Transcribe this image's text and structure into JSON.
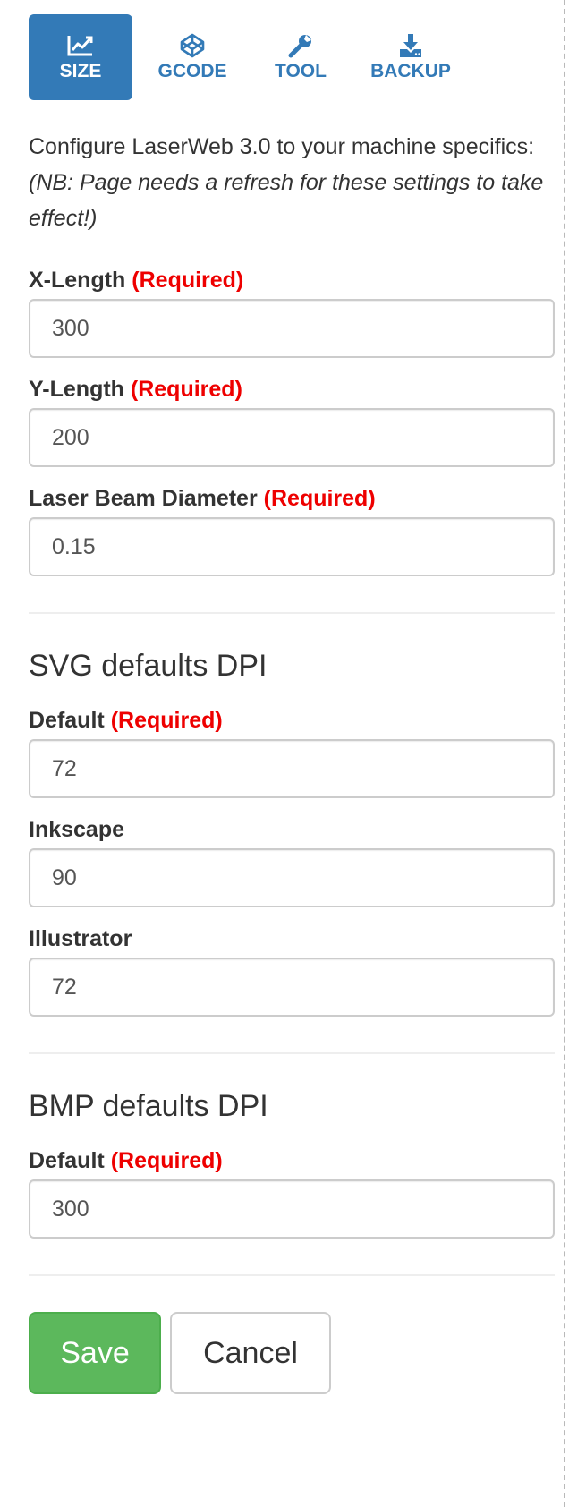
{
  "tabs": [
    {
      "label": "SIZE",
      "icon": "chart-line-icon",
      "active": true
    },
    {
      "label": "GCODE",
      "icon": "codepen-cube-icon",
      "active": false
    },
    {
      "label": "TOOL",
      "icon": "wrench-icon",
      "active": false
    },
    {
      "label": "BACKUP",
      "icon": "download-icon",
      "active": false
    }
  ],
  "intro": {
    "text": "Configure LaserWeb 3.0 to your machine specifics:",
    "note": "(NB: Page needs a refresh for these settings to take effect!)"
  },
  "required_marker": "(Required)",
  "machine": {
    "x_length": {
      "label": "X-Length",
      "value": "300"
    },
    "y_length": {
      "label": "Y-Length",
      "value": "200"
    },
    "beam": {
      "label": "Laser Beam Diameter",
      "value": "0.15"
    }
  },
  "svg": {
    "title": "SVG defaults DPI",
    "default": {
      "label": "Default",
      "value": "72"
    },
    "inkscape": {
      "label": "Inkscape",
      "value": "90"
    },
    "illustrator": {
      "label": "Illustrator",
      "value": "72"
    }
  },
  "bmp": {
    "title": "BMP defaults DPI",
    "default": {
      "label": "Default",
      "value": "300"
    }
  },
  "buttons": {
    "save": "Save",
    "cancel": "Cancel"
  },
  "colors": {
    "accent": "#337ab7",
    "required": "#ee0000",
    "save": "#5cb85c"
  }
}
